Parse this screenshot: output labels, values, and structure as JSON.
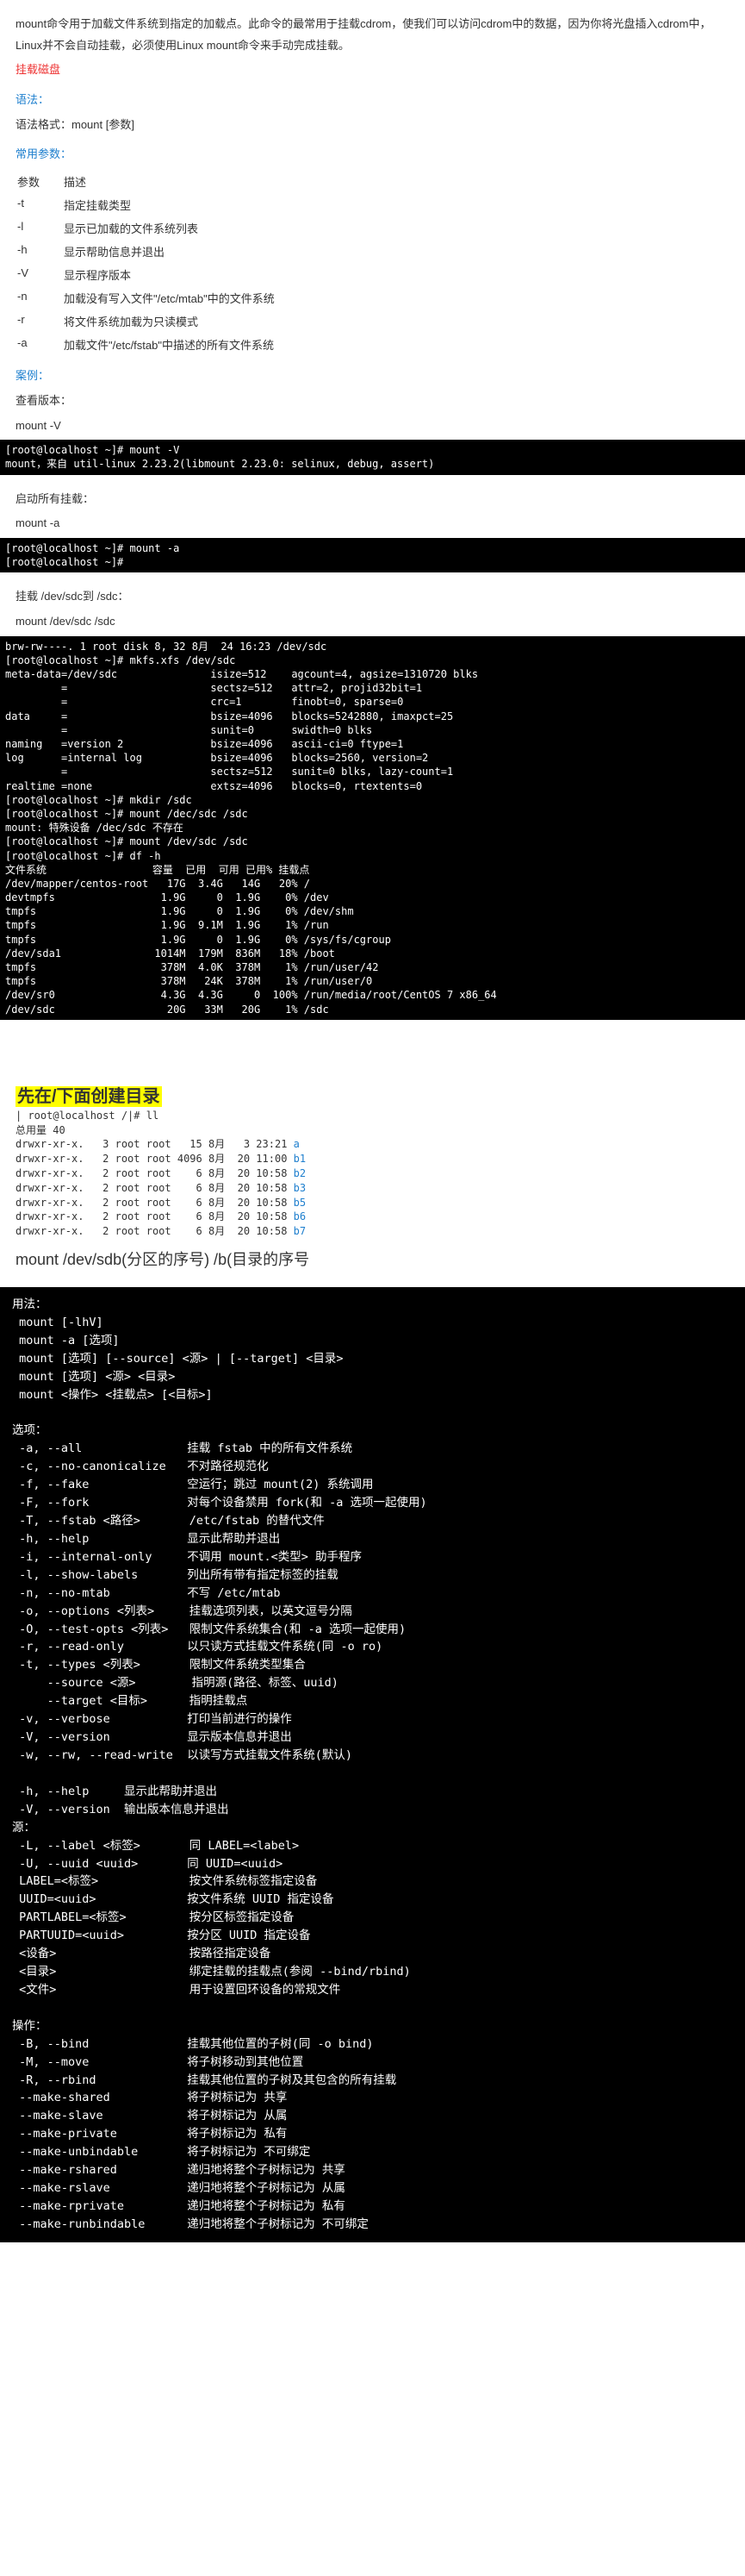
{
  "intro": {
    "p1": "mount命令用于加载文件系统到指定的加载点。此命令的最常用于挂载cdrom，使我们可以访问cdrom中的数据，因为你将光盘插入cdrom中，Linux并不会自动挂载，必须使用Linux mount命令来手动完成挂载。",
    "p2": "挂载磁盘"
  },
  "syntax": {
    "title": "语法：",
    "text": "语法格式：mount [参数]"
  },
  "params": {
    "title": "常用参数：",
    "header_opt": "参数",
    "header_desc": "描述",
    "rows": [
      {
        "opt": "-t",
        "desc": "指定挂载类型"
      },
      {
        "opt": "-l",
        "desc": "显示已加载的文件系统列表"
      },
      {
        "opt": "-h",
        "desc": "显示帮助信息并退出"
      },
      {
        "opt": "-V",
        "desc": "显示程序版本"
      },
      {
        "opt": "-n",
        "desc": "加载没有写入文件\"/etc/mtab\"中的文件系统"
      },
      {
        "opt": "-r",
        "desc": "将文件系统加载为只读模式"
      },
      {
        "opt": "-a",
        "desc": "加载文件\"/etc/fstab\"中描述的所有文件系统"
      }
    ]
  },
  "examples": {
    "title": "案例：",
    "ver_label": "查看版本：",
    "ver_cmd": "mount -V",
    "ver_term": "[root@localhost ~]# mount -V\nmount，来自 util-linux 2.23.2(libmount 2.23.0: selinux, debug, assert)",
    "all_label": "启动所有挂载：",
    "all_cmd": "mount -a",
    "all_term": "[root@localhost ~]# mount -a\n[root@localhost ~]#",
    "sdc_label": "挂载 /dev/sdc到 /sdc：",
    "sdc_cmd": "mount /dev/sdc /sdc",
    "sdc_term": "brw-rw----. 1 root disk 8, 32 8月  24 16:23 /dev/sdc\n[root@localhost ~]# mkfs.xfs /dev/sdc\nmeta-data=/dev/sdc               isize=512    agcount=4, agsize=1310720 blks\n         =                       sectsz=512   attr=2, projid32bit=1\n         =                       crc=1        finobt=0, sparse=0\ndata     =                       bsize=4096   blocks=5242880, imaxpct=25\n         =                       sunit=0      swidth=0 blks\nnaming   =version 2              bsize=4096   ascii-ci=0 ftype=1\nlog      =internal log           bsize=4096   blocks=2560, version=2\n         =                       sectsz=512   sunit=0 blks, lazy-count=1\nrealtime =none                   extsz=4096   blocks=0, rtextents=0\n[root@localhost ~]# mkdir /sdc\n[root@localhost ~]# mount /dec/sdc /sdc\nmount: 特殊设备 /dec/sdc 不存在\n[root@localhost ~]# mount /dev/sdc /sdc\n[root@localhost ~]# df -h\n文件系统                 容量  已用  可用 已用% 挂载点\n/dev/mapper/centos-root   17G  3.4G   14G   20% /\ndevtmpfs                 1.9G     0  1.9G    0% /dev\ntmpfs                    1.9G     0  1.9G    0% /dev/shm\ntmpfs                    1.9G  9.1M  1.9G    1% /run\ntmpfs                    1.9G     0  1.9G    0% /sys/fs/cgroup\n/dev/sda1               1014M  179M  836M   18% /boot\ntmpfs                    378M  4.0K  378M    1% /run/user/42\ntmpfs                    378M   24K  378M    1% /run/user/0\n/dev/sr0                 4.3G  4.3G     0  100% /run/media/root/CentOS 7 x86_64\n/dev/sdc                  20G   33M   20G    1% /sdc"
  },
  "mkdir": {
    "title": "先在/下面创建目录",
    "ls": "| root@localhost /|# ll\n总用量 40\ndrwxr-xr-x.   3 root root   15 8月   3 23:21 a\ndrwxr-xr-x.   2 root root 4096 8月  20 11:00 b1\ndrwxr-xr-x.   2 root root    6 8月  20 10:58 b2\ndrwxr-xr-x.   2 root root    6 8月  20 10:58 b3\ndrwxr-xr-x.   2 root root    6 8月  20 10:58 b5\ndrwxr-xr-x.   2 root root    6 8月  20 10:58 b6\ndrwxr-xr-x.   2 root root    6 8月  20 10:58 b7",
    "cmd": "mount  /dev/sdb(分区的序号)  /b(目录的序号"
  },
  "help": "用法：\n mount [-lhV]\n mount -a [选项]\n mount [选项] [--source] <源> | [--target] <目录>\n mount [选项] <源> <目录>\n mount <操作> <挂载点> [<目标>]\n\n选项：\n -a, --all               挂载 fstab 中的所有文件系统\n -c, --no-canonicalize   不对路径规范化\n -f, --fake              空运行；跳过 mount(2) 系统调用\n -F, --fork              对每个设备禁用 fork(和 -a 选项一起使用)\n -T, --fstab <路径>       /etc/fstab 的替代文件\n -h, --help              显示此帮助并退出\n -i, --internal-only     不调用 mount.<类型> 助手程序\n -l, --show-labels       列出所有带有指定标签的挂载\n -n, --no-mtab           不写 /etc/mtab\n -o, --options <列表>     挂载选项列表，以英文逗号分隔\n -O, --test-opts <列表>   限制文件系统集合(和 -a 选项一起使用)\n -r, --read-only         以只读方式挂载文件系统(同 -o ro)\n -t, --types <列表>       限制文件系统类型集合\n     --source <源>        指明源(路径、标签、uuid)\n     --target <目标>      指明挂载点\n -v, --verbose           打印当前进行的操作\n -V, --version           显示版本信息并退出\n -w, --rw, --read-write  以读写方式挂载文件系统(默认)\n\n -h, --help     显示此帮助并退出\n -V, --version  输出版本信息并退出\n源：\n -L, --label <标签>       同 LABEL=<label>\n -U, --uuid <uuid>       同 UUID=<uuid>\n LABEL=<标签>             按文件系统标签指定设备\n UUID=<uuid>             按文件系统 UUID 指定设备\n PARTLABEL=<标签>         按分区标签指定设备\n PARTUUID=<uuid>         按分区 UUID 指定设备\n <设备>                   按路径指定设备\n <目录>                   绑定挂载的挂载点(参阅 --bind/rbind)\n <文件>                   用于设置回环设备的常规文件\n\n操作：\n -B, --bind              挂载其他位置的子树(同 -o bind)\n -M, --move              将子树移动到其他位置\n -R, --rbind             挂载其他位置的子树及其包含的所有挂载\n --make-shared           将子树标记为 共享\n --make-slave            将子树标记为 从属\n --make-private          将子树标记为 私有\n --make-unbindable       将子树标记为 不可绑定\n --make-rshared          递归地将整个子树标记为 共享\n --make-rslave           递归地将整个子树标记为 从属\n --make-rprivate         递归地将整个子树标记为 私有\n --make-runbindable      递归地将整个子树标记为 不可绑定"
}
